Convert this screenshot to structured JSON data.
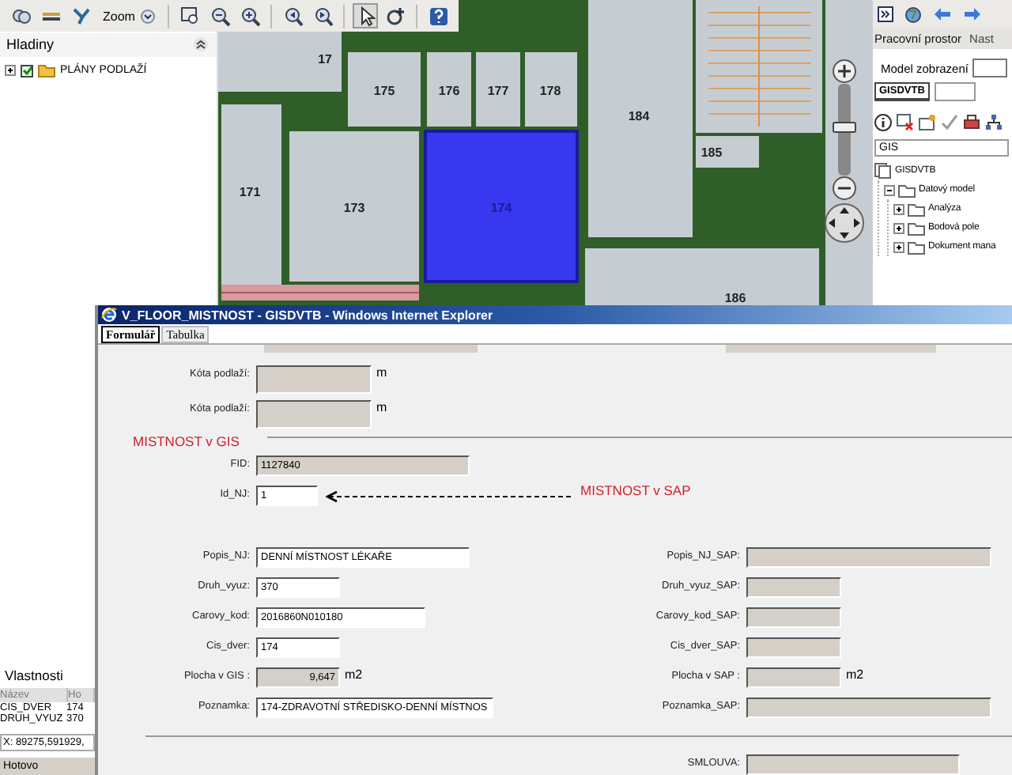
{
  "toolbar": {
    "zoom_label": "Zoom",
    "tools": [
      {
        "selected": false
      },
      {
        "selected": false
      },
      {
        "selected": false
      },
      {
        "selected": false
      },
      {
        "selected": false
      },
      {
        "selected": false
      },
      {
        "selected": false
      },
      {
        "selected": false
      },
      {
        "selected": true
      },
      {
        "selected": false
      },
      {
        "selected": false
      }
    ]
  },
  "layers_panel": {
    "title": "Hladiny",
    "items": [
      {
        "label": "PLÁNY PODLAŽÍ",
        "checked": true,
        "expanded": false
      }
    ]
  },
  "map": {
    "rooms": [
      {
        "label": "17",
        "selected": false
      },
      {
        "label": "175",
        "selected": false
      },
      {
        "label": "176",
        "selected": false
      },
      {
        "label": "177",
        "selected": false
      },
      {
        "label": "178",
        "selected": false
      },
      {
        "label": "171",
        "selected": false
      },
      {
        "label": "173",
        "selected": false
      },
      {
        "label": "174",
        "selected": true
      },
      {
        "label": "184",
        "selected": false
      },
      {
        "label": "185",
        "selected": false
      },
      {
        "label": "186",
        "selected": false
      }
    ],
    "zoom_slider": {
      "level": 0.55
    }
  },
  "right_panel": {
    "tabs": [
      {
        "label": "Pracovní prostor",
        "selected": true
      },
      {
        "label": "Nast",
        "selected": false
      }
    ],
    "model_label": "Model zobrazení",
    "view_tabs": [
      {
        "label": "GISDVTB",
        "selected": true
      }
    ],
    "search_value": "GIS",
    "tree": [
      {
        "label": "GISDVTB",
        "children": [
          {
            "label": "Datový model",
            "expanded": true,
            "children": [
              {
                "label": "Analýza",
                "expanded": false
              },
              {
                "label": "Bodová pole",
                "expanded": false
              },
              {
                "label": "Dokument mana",
                "expanded": false
              }
            ]
          }
        ]
      }
    ]
  },
  "properties_panel": {
    "title": "Vlastnosti",
    "columns": [
      "Název",
      "Ho"
    ],
    "rows": [
      [
        "CIS_DVER",
        "174"
      ],
      [
        "DRUH_VYUZ",
        "370"
      ]
    ],
    "coordinates": "X: 89275,591929,"
  },
  "status_bar": "Hotovo",
  "popup": {
    "title": "V_FLOOR_MISTNOST - GISDVTB - Windows Internet Explorer",
    "tabs": [
      {
        "label": "Formulář",
        "selected": true
      },
      {
        "label": "Tabulka",
        "selected": false
      }
    ],
    "top_fields": [
      {
        "label": "Kóta podlaží:",
        "unit": "m",
        "editable": false
      },
      {
        "label": "Kóta podlaží:",
        "unit": "m",
        "editable": false
      }
    ],
    "gis_heading": "MISTNOST v GIS",
    "id_fields": [
      {
        "label": "FID:",
        "value": "1127840",
        "editable": false
      },
      {
        "label": "Id_NJ:",
        "value": "1",
        "editable": true
      }
    ],
    "sap_note": "MISTNOST v SAP",
    "gis_fields": [
      {
        "label": "Popis_NJ:",
        "value": "DENNÍ MÍSTNOST LÉKAŘE",
        "editable": true
      },
      {
        "label": "Druh_vyuz:",
        "value": "370",
        "editable": true
      },
      {
        "label": "Carovy_kod:",
        "value": "2016860N010180",
        "editable": true
      },
      {
        "label": "Cis_dver:",
        "value": "174",
        "editable": true
      },
      {
        "label": "Plocha v GIS :",
        "value": "9,647",
        "unit": "m2",
        "editable": false
      },
      {
        "label": "Poznamka:",
        "value": "174-ZDRAVOTNÍ STŘEDISKO-DENNÍ MÍSTNOS",
        "editable": true
      }
    ],
    "sap_fields": [
      {
        "label": "Popis_NJ_SAP:",
        "editable": false
      },
      {
        "label": "Druh_vyuz_SAP:",
        "editable": false
      },
      {
        "label": "Carovy_kod_SAP:",
        "editable": false
      },
      {
        "label": "Cis_dver_SAP:",
        "editable": false
      },
      {
        "label": "Plocha v SAP :",
        "unit": "m2",
        "editable": false
      },
      {
        "label": "Poznamka_SAP:",
        "editable": false
      }
    ],
    "contract_field": {
      "label": "SMLOUVA:",
      "editable": false
    }
  }
}
